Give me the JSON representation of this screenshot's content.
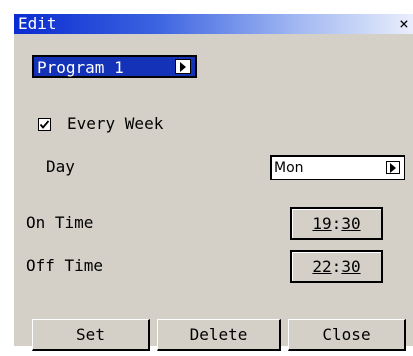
{
  "window": {
    "title": "Edit",
    "close_glyph": "×"
  },
  "program": {
    "selected": "Program 1"
  },
  "every_week": {
    "label": "Every Week",
    "checked": true
  },
  "day": {
    "label": "Day",
    "value": "Mon"
  },
  "on_time": {
    "label": "On  Time",
    "hour": "19",
    "minute": "30"
  },
  "off_time": {
    "label": "Off Time",
    "hour": "22",
    "minute": "30"
  },
  "buttons": {
    "set": "Set",
    "delete": "Delete",
    "close": "Close"
  },
  "colors": {
    "titlebar_start": "#0a2bd0",
    "selection": "#1432b8",
    "face": "#d4d0c8"
  }
}
